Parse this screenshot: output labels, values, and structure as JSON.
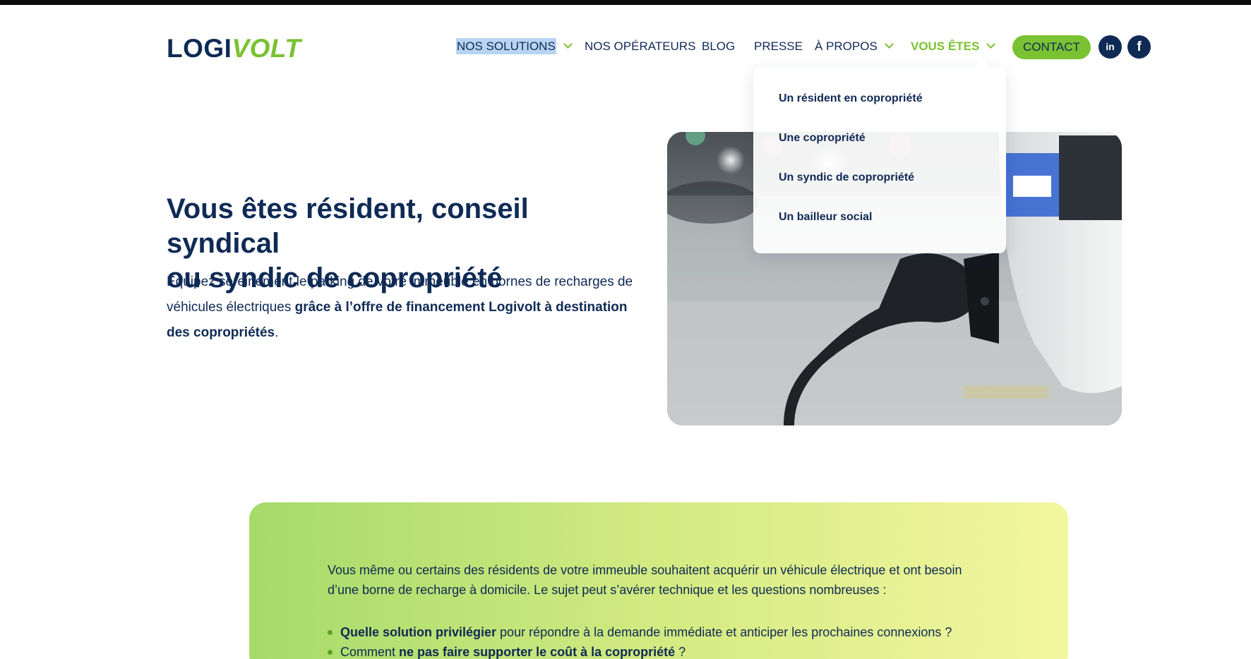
{
  "logo": {
    "part1": "LOGI",
    "part2": "VOLT"
  },
  "nav": {
    "items": [
      {
        "label": "NOS SOLUTIONS"
      },
      {
        "label": "NOS OPÉRATEURS"
      },
      {
        "label": "BLOG"
      },
      {
        "label": "PRESSE"
      },
      {
        "label": "À PROPOS"
      },
      {
        "label": "VOUS ÊTES"
      }
    ],
    "contact_label": "CONTACT",
    "linkedin_label": "in",
    "facebook_label": "f"
  },
  "dropdown": {
    "items": [
      {
        "label": "Un résident en copropriété"
      },
      {
        "label": "Une copropriété"
      },
      {
        "label": "Un syndic de copropriété"
      },
      {
        "label": "Un bailleur social"
      }
    ]
  },
  "hero": {
    "title_1": "Vous êtes ",
    "title_2": "résident",
    "title_3": ", ",
    "title_4": "conseil syndical",
    "title_5": "ou ",
    "title_6": "syndic de copropriété",
    "text_1": "Équipez sereinement le parking de votre immeuble en bornes de recharges de véhicules électriques ",
    "text_2": "grâce à l’offre de financement Logivolt à destination des copropriétés",
    "text_3": "."
  },
  "info": {
    "paragraph": "Vous même ou certains des résidents de votre immeuble souhaitent acquérir un véhicule électrique et ont besoin d’une borne de recharge à domicile. Le sujet peut s’avérer technique et les questions nombreuses :",
    "bullet1_bold": "Quelle solution privilégier",
    "bullet1_rest": " pour répondre à la demande immédiate et anticiper les prochaines connexions ?",
    "bullet2_start": "Comment ",
    "bullet2_bold": "ne pas faire supporter le coût à la copropriété",
    "bullet2_end": " ?"
  },
  "colors": {
    "navy": "#0f2a55",
    "green": "#7ac231",
    "highlight": "#b9d4f2"
  },
  "icons": [
    "chevron-down-icon",
    "linkedin-icon",
    "facebook-icon"
  ]
}
